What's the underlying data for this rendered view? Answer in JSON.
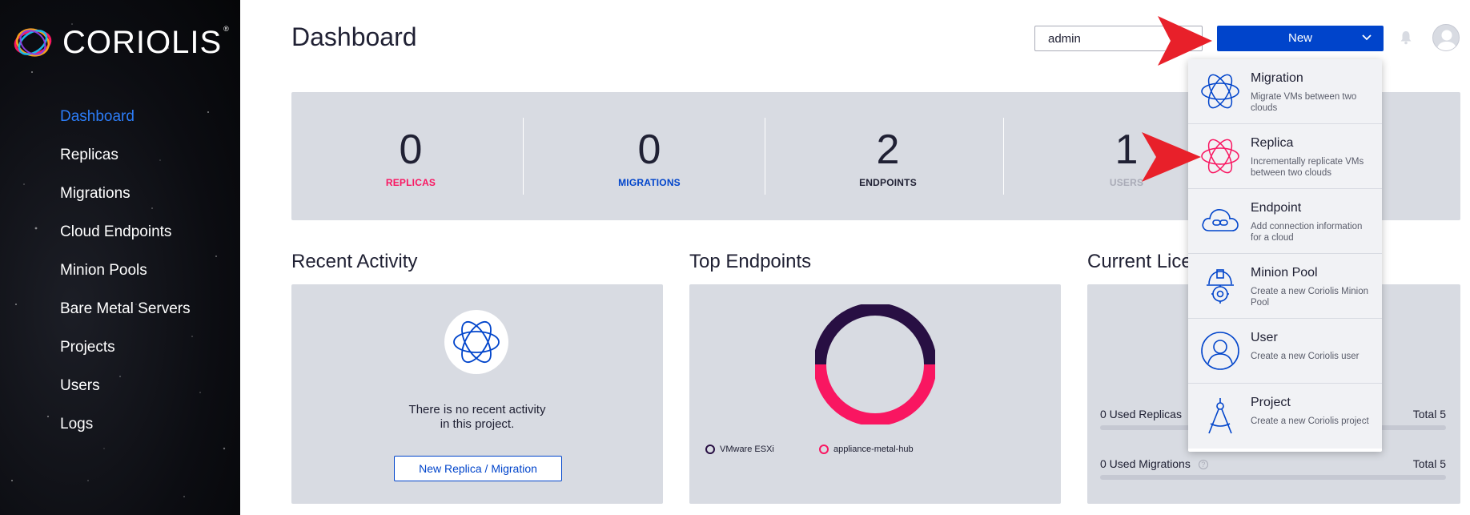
{
  "app": {
    "logo_text": "CORIOLIS",
    "logo_mark": "®"
  },
  "sidebar": {
    "items": [
      {
        "label": "Dashboard"
      },
      {
        "label": "Replicas"
      },
      {
        "label": "Migrations"
      },
      {
        "label": "Cloud Endpoints"
      },
      {
        "label": "Minion Pools"
      },
      {
        "label": "Bare Metal Servers"
      },
      {
        "label": "Projects"
      },
      {
        "label": "Users"
      },
      {
        "label": "Logs"
      }
    ]
  },
  "header": {
    "title": "Dashboard",
    "project_select": "admin",
    "new_button": "New"
  },
  "stats": [
    {
      "value": "0",
      "label": "REPLICAS",
      "color": "#f91661"
    },
    {
      "value": "0",
      "label": "MIGRATIONS",
      "color": "#0044cb"
    },
    {
      "value": "2",
      "label": "ENDPOINTS",
      "color": "#202134"
    },
    {
      "value": "1",
      "label": "USERS",
      "color": "#a9abb7"
    }
  ],
  "recent_activity": {
    "title": "Recent Activity",
    "empty_line1": "There is no recent activity",
    "empty_line2": "in this project.",
    "button": "New Replica / Migration"
  },
  "top_endpoints": {
    "title": "Top Endpoints",
    "legend": [
      {
        "label": "VMware ESXi",
        "color": "#280f43"
      },
      {
        "label": "appliance-metal-hub",
        "color": "#f91661"
      }
    ]
  },
  "licence": {
    "title": "Current Lice",
    "rows": [
      {
        "label": "0 Used Replicas",
        "total": "Total 5"
      },
      {
        "label": "0 Used Migrations",
        "total": "Total 5"
      }
    ],
    "help": "?"
  },
  "new_menu": {
    "items": [
      {
        "title": "Migration",
        "desc": "Migrate VMs between two clouds",
        "icon": "migration-icon"
      },
      {
        "title": "Replica",
        "desc": "Incrementally replicate VMs between two clouds",
        "icon": "replica-icon"
      },
      {
        "title": "Endpoint",
        "desc": "Add connection information for a cloud",
        "icon": "endpoint-icon"
      },
      {
        "title": "Minion Pool",
        "desc": "Create a new Coriolis Minion Pool",
        "icon": "minion-pool-icon"
      },
      {
        "title": "User",
        "desc": "Create a new Coriolis user",
        "icon": "user-icon"
      },
      {
        "title": "Project",
        "desc": "Create a new Coriolis project",
        "icon": "project-icon"
      }
    ]
  },
  "colors": {
    "accent_blue": "#0044cb",
    "replica_pink": "#f91661",
    "nav_active": "#2c7cf6",
    "panel_bg": "#d8dbe2",
    "annotation_red": "#e8202a"
  }
}
